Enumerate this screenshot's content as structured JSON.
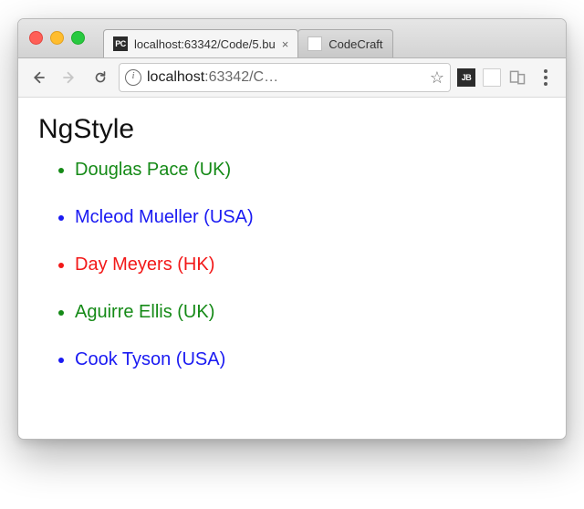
{
  "browser": {
    "tabs": [
      {
        "favicon": "PC",
        "title": "localhost:63342/Code/5.bu",
        "active": true
      },
      {
        "favicon": "",
        "title": "CodeCraft",
        "active": false
      }
    ],
    "address": {
      "host": "localhost",
      "port_path": ":63342/C…"
    },
    "extensions": {
      "jb_label": "JB"
    }
  },
  "page": {
    "heading": "NgStyle",
    "people": [
      {
        "name": "Douglas Pace",
        "country": "UK"
      },
      {
        "name": "Mcleod Mueller",
        "country": "USA"
      },
      {
        "name": "Day Meyers",
        "country": "HK"
      },
      {
        "name": "Aguirre Ellis",
        "country": "UK"
      },
      {
        "name": "Cook Tyson",
        "country": "USA"
      }
    ]
  }
}
